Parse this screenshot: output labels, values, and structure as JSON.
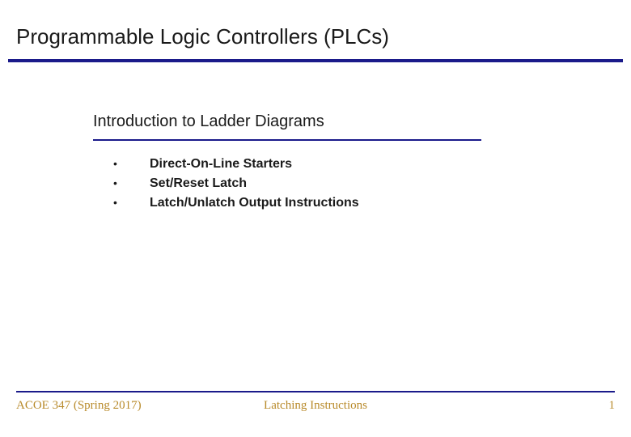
{
  "title": "Programmable Logic Controllers (PLCs)",
  "subtitle": "Introduction to Ladder Diagrams",
  "bullets": [
    "Direct-On-Line Starters",
    "Set/Reset Latch",
    "Latch/Unlatch Output Instructions"
  ],
  "footer": {
    "left": "ACOE 347 (Spring 2017)",
    "center": "Latching Instructions",
    "right": "1"
  }
}
